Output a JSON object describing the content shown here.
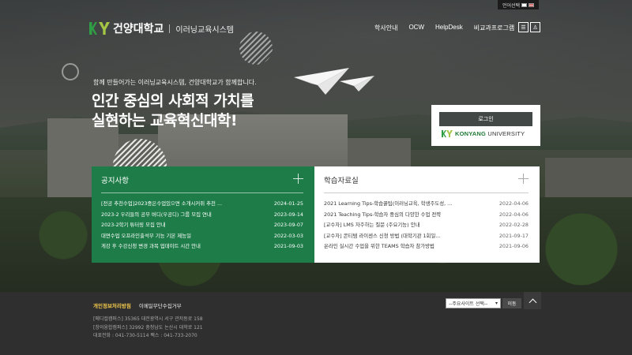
{
  "header": {
    "language": "언어선택",
    "logo_name": "건양대학교",
    "logo_sub": "이러닝교육시스템",
    "nav": [
      "학사안내",
      "OCW",
      "HelpDesk",
      "비교과프로그램"
    ],
    "menu_icon": "hamburger-icon",
    "user_icon": "user-icon"
  },
  "hero": {
    "subtitle": "함께 만들어가는 이러닝교육시스템, 건양대학교가 함께합니다.",
    "title_line1": "인간 중심의 사회적 가치를",
    "title_line2": "실현하는 교육혁신대학!"
  },
  "login": {
    "button": "로그인",
    "brand_prefix": "KONYANG",
    "brand_suffix": "UNIVERSITY"
  },
  "notice": {
    "title": "공지사항",
    "items": [
      {
        "title": "[전공 추천수업]2023중은수업있으면 소개시커쥐 추천 ...",
        "date": "2024-01-25"
      },
      {
        "title": "2023-2 우리들의 공부 버디(우공디) 그룹 모집 연내",
        "date": "2023-09-14"
      },
      {
        "title": "2023-2학기 튜터링 모집 안내",
        "date": "2023-09-07"
      },
      {
        "title": "대면수업 오프라인출석부 기능 기본 제능일",
        "date": "2022-03-03"
      },
      {
        "title": "게강 후 수강신청 변경 과목 업데이트 시간 안내",
        "date": "2021-09-03"
      }
    ]
  },
  "study": {
    "title": "학습자료실",
    "items": [
      {
        "title": "2021 Learning Tips-학습꿀팁(이러닝교육, 학생주도성, ...",
        "date": "2022-04-06"
      },
      {
        "title": "2021 Teaching Tips-학습자 중심의 다양한 수업 전략",
        "date": "2022-04-06"
      },
      {
        "title": "[교수자] LMS 자주하는 질문 (주요기능) 안내",
        "date": "2022-02-28"
      },
      {
        "title": "[교수자] 콘티템 라이센스 신청 방법 (대학기관 1회일...",
        "date": "2021-09-17"
      },
      {
        "title": "온라인 실시간 수업을 위한 TEAMS 학습자 참가방법",
        "date": "2021-09-06"
      }
    ]
  },
  "footer": {
    "privacy": "개인정보처리방침",
    "email": "이메일무단수집거부",
    "addr1": "[메디컬캠퍼스] 35365 대전광역시 서구 관저동로 158",
    "addr2": "[창의융합캠퍼스] 32992 충청남도 논산시 대학로 121",
    "addr3": "대표전화 : 041-730-5114 팩스 : 041-733-2070",
    "site_select": "--주요사이트 선택--",
    "go": "이동",
    "top_icon": "arrow-up-icon"
  },
  "colors": {
    "notice_bg": "#1e7c48",
    "login_btn": "#414846",
    "privacy": "#f2c94c",
    "logo_k": "#2f9e44",
    "logo_y": "#a3c644"
  }
}
